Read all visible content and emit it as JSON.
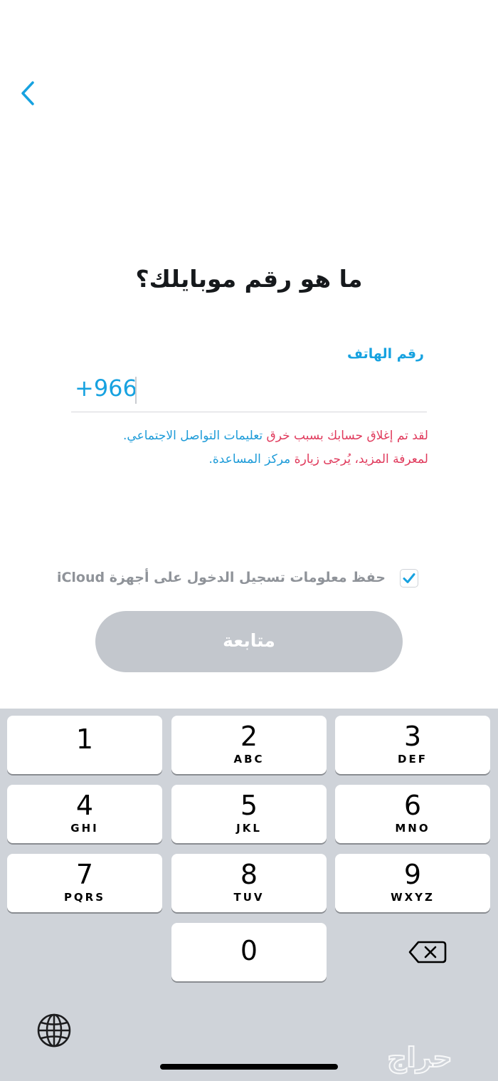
{
  "header": {
    "back_icon": "chevron-left-icon"
  },
  "title": "ما هو رقم موبايلك؟",
  "phone": {
    "label": "رقم الهاتف",
    "country_code": "+966",
    "value": ""
  },
  "message": {
    "line1_part1": "لقد تم إغلاق حسابك بسبب خرق ",
    "line1_link": "تعليمات التواصل الاجتماعي.",
    "line2_part1": "لمعرفة المزيد، يُرجى زيارة ",
    "line2_link": "مركز المساعدة."
  },
  "remember": {
    "label": "حفظ معلومات تسجيل الدخول على أجهزة iCloud",
    "checked": true
  },
  "continue_label": "متابعة",
  "keyboard": {
    "keys": [
      {
        "digit": "1",
        "letters": ""
      },
      {
        "digit": "2",
        "letters": "ABC"
      },
      {
        "digit": "3",
        "letters": "DEF"
      },
      {
        "digit": "4",
        "letters": "GHI"
      },
      {
        "digit": "5",
        "letters": "JKL"
      },
      {
        "digit": "6",
        "letters": "MNO"
      },
      {
        "digit": "7",
        "letters": "PQRS"
      },
      {
        "digit": "8",
        "letters": "TUV"
      },
      {
        "digit": "9",
        "letters": "WXYZ"
      },
      {
        "digit": "0",
        "letters": ""
      }
    ],
    "delete_icon": "backspace-icon",
    "globe_icon": "globe-icon"
  },
  "watermark": "حراج",
  "colors": {
    "accent": "#17a2e0",
    "error": "#e03a5c",
    "button_disabled": "#c3c7cd",
    "keyboard_bg": "#cfd3d9"
  }
}
